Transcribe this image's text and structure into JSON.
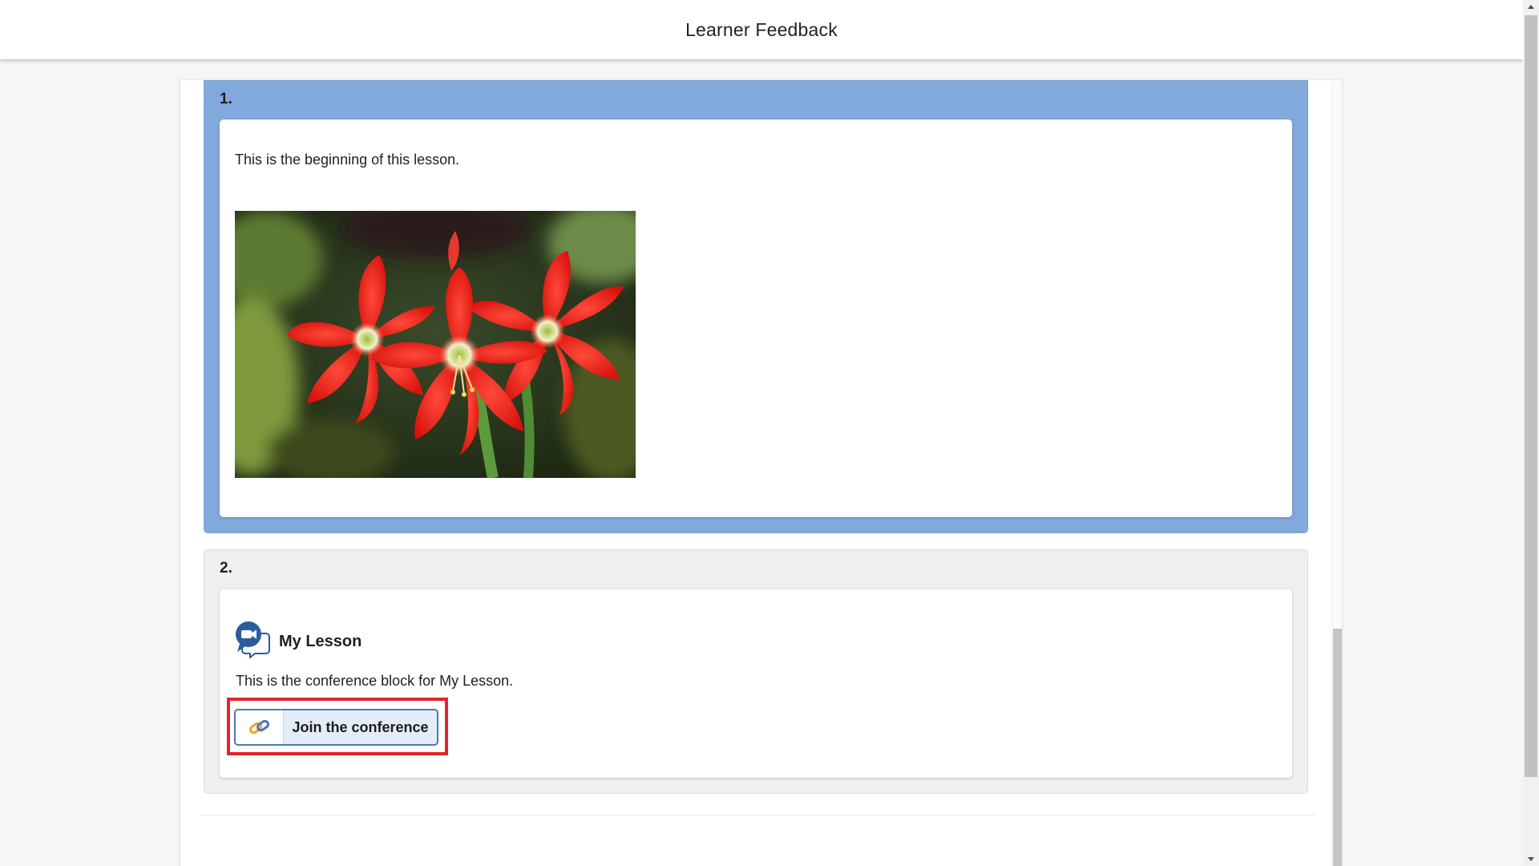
{
  "header": {
    "title": "Learner Feedback"
  },
  "blocks": [
    {
      "number": "1.",
      "text": "This is the beginning of this lesson.",
      "image": {
        "subject": "red-amaryllis-flowers"
      },
      "color": "#81a9dc"
    },
    {
      "number": "2.",
      "conference": {
        "title": "My Lesson",
        "description": "This is the conference block for My Lesson.",
        "button_label": "Join the conference",
        "icon": "video-chat-icon",
        "button_icon": "link-icon"
      },
      "color": "#efefef"
    }
  ],
  "colors": {
    "highlight": "#e3242b",
    "button_border": "#4a78b5",
    "button_bg": "#e3edf9"
  }
}
